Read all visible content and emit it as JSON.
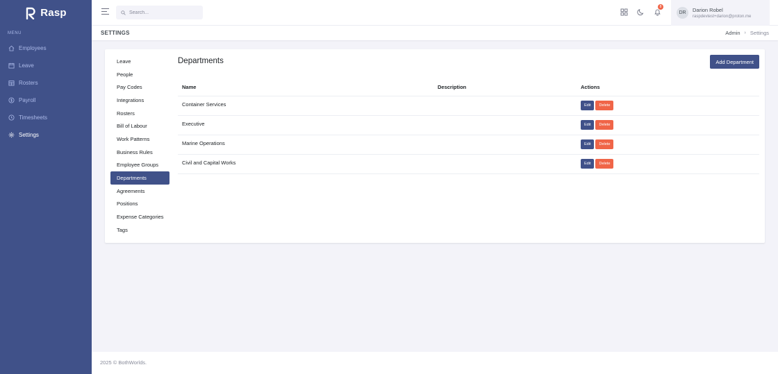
{
  "brand": {
    "name": "Rasp"
  },
  "sidebar": {
    "menu_title": "MENU",
    "items": [
      {
        "label": "Employees",
        "icon": "home-icon"
      },
      {
        "label": "Leave",
        "icon": "calendar-icon"
      },
      {
        "label": "Rosters",
        "icon": "calendar-grid-icon"
      },
      {
        "label": "Payroll",
        "icon": "dollar-circle-icon"
      },
      {
        "label": "Timesheets",
        "icon": "clock-icon"
      },
      {
        "label": "Settings",
        "icon": "gear-icon",
        "active": true
      }
    ]
  },
  "topbar": {
    "search_placeholder": "Search...",
    "notification_count": "8",
    "user": {
      "initials": "DR",
      "name": "Darion Robel",
      "email": "raspdevtest+darion@proton.me"
    }
  },
  "titlebar": {
    "title": "SETTINGS",
    "breadcrumb": [
      "Admin",
      "Settings"
    ]
  },
  "settings_nav": [
    "Leave",
    "People",
    "Pay Codes",
    "Integrations",
    "Rosters",
    "Bill of Labour",
    "Work Patterns",
    "Business Rules",
    "Employee Groups",
    "Departments",
    "Agreements",
    "Positions",
    "Expense Categories",
    "Tags"
  ],
  "settings_nav_active": "Departments",
  "departments": {
    "title": "Departments",
    "add_label": "Add Department",
    "columns": [
      "Name",
      "Description",
      "Actions"
    ],
    "rows": [
      {
        "name": "Container Services",
        "description": ""
      },
      {
        "name": "Executive",
        "description": ""
      },
      {
        "name": "Marine Operations",
        "description": ""
      },
      {
        "name": "Civil and Capital Works",
        "description": ""
      }
    ],
    "edit_label": "Edit",
    "delete_label": "Delete"
  },
  "footer": {
    "text": "2025 © BothWorlds."
  },
  "colors": {
    "primary": "#405189",
    "danger": "#f06548",
    "background": "#f3f3f9"
  }
}
